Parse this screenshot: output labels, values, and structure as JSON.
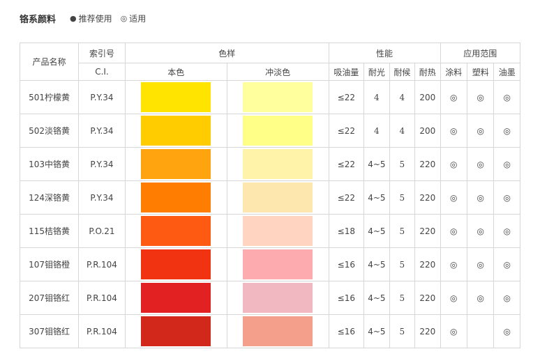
{
  "header": {
    "title": "铬系颜料",
    "legend": [
      {
        "symbol": "●",
        "label": "推荐使用"
      },
      {
        "symbol": "◎",
        "label": "适用"
      }
    ]
  },
  "table": {
    "head": {
      "product_name": "产品名称",
      "index_no": "索引号",
      "ci": "C.I.",
      "color_group": "色样",
      "mass_tone": "本色",
      "tint": "冲淡色",
      "property_group": "性能",
      "oil_absorption": "吸油量",
      "lightfastness": "耐光",
      "weather": "耐候",
      "heat": "耐热",
      "application_group": "应用范围",
      "coating": "涂料",
      "plastic": "塑料",
      "ink": "油墨"
    },
    "rows": [
      {
        "name": "501柠檬黄",
        "ci": "P.Y.34",
        "base": "#ffe400",
        "tint": "#ffff9e",
        "oil": "≤22",
        "light": "4",
        "weather": "4",
        "heat": "200",
        "coating": "◎",
        "plastic": "◎",
        "ink": "◎"
      },
      {
        "name": "502淡铬黄",
        "ci": "P.Y.34",
        "base": "#ffcc00",
        "tint": "#ffff88",
        "oil": "≤22",
        "light": "4",
        "weather": "4",
        "heat": "200",
        "coating": "◎",
        "plastic": "◎",
        "ink": "◎"
      },
      {
        "name": "103中铬黄",
        "ci": "P.Y.34",
        "base": "#ffa30e",
        "tint": "#fef3a8",
        "oil": "≤22",
        "light": "4~5",
        "weather": "5",
        "heat": "220",
        "coating": "◎",
        "plastic": "◎",
        "ink": "◎"
      },
      {
        "name": "124深铬黄",
        "ci": "P.Y.34",
        "base": "#ff7d00",
        "tint": "#fde7ae",
        "oil": "≤22",
        "light": "4~5",
        "weather": "5",
        "heat": "220",
        "coating": "◎",
        "plastic": "◎",
        "ink": "◎"
      },
      {
        "name": "115桔铬黄",
        "ci": "P.O.21",
        "base": "#ff5a12",
        "tint": "#ffd5c2",
        "oil": "≤18",
        "light": "4~5",
        "weather": "5",
        "heat": "220",
        "coating": "◎",
        "plastic": "◎",
        "ink": "◎"
      },
      {
        "name": "107钼铬橙",
        "ci": "P.R.104",
        "base": "#f23312",
        "tint": "#feabaf",
        "oil": "≤16",
        "light": "4~5",
        "weather": "5",
        "heat": "220",
        "coating": "◎",
        "plastic": "◎",
        "ink": "◎"
      },
      {
        "name": "207钼铬红",
        "ci": "P.R.104",
        "base": "#e22122",
        "tint": "#f2b8c2",
        "oil": "≤16",
        "light": "4~5",
        "weather": "5",
        "heat": "220",
        "coating": "◎",
        "plastic": "◎",
        "ink": "◎"
      },
      {
        "name": "307钼铬红",
        "ci": "P.R.104",
        "base": "#d2281b",
        "tint": "#f49f8c",
        "oil": "≤16",
        "light": "4~5",
        "weather": "5",
        "heat": "220",
        "coating": "◎",
        "plastic": "",
        "ink": "◎"
      }
    ]
  }
}
